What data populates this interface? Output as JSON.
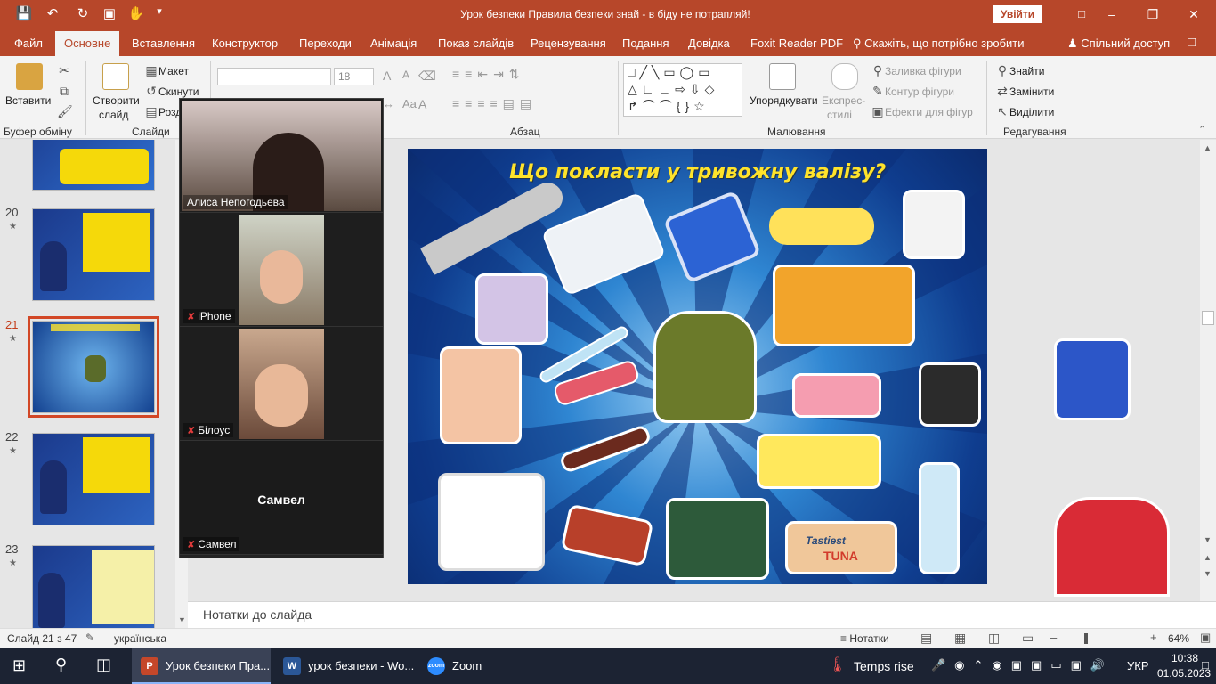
{
  "window": {
    "title": "Урок безпеки Правила безпеки знай - в біду не потрапляй!",
    "signin": "Увійти"
  },
  "tabs": [
    {
      "label": "Файл"
    },
    {
      "label": "Основне"
    },
    {
      "label": "Вставлення"
    },
    {
      "label": "Конструктор"
    },
    {
      "label": "Переходи"
    },
    {
      "label": "Анімація"
    },
    {
      "label": "Показ слайдів"
    },
    {
      "label": "Рецензування"
    },
    {
      "label": "Подання"
    },
    {
      "label": "Довідка"
    },
    {
      "label": "Foxit Reader PDF"
    }
  ],
  "tell_me": "Скажіть, що потрібно зробити",
  "share": "Спільний доступ",
  "ribbon": {
    "paste": "Вставити",
    "clipboard": "Буфер обміну",
    "new_slide_1": "Створити",
    "new_slide_2": "слайд",
    "layout": "Макет",
    "reset": "Скинути",
    "section": "Розділ",
    "slides": "Слайди",
    "font_size": "18",
    "paragraph": "Абзац",
    "arrange": "Упорядкувати",
    "express_1": "Експрес-",
    "express_2": "стилі",
    "fill": "Заливка фігури",
    "outline": "Контур фігури",
    "effects": "Ефекти для фігур",
    "drawing": "Малювання",
    "find": "Знайти",
    "replace": "Замінити",
    "select": "Виділити",
    "editing": "Редагування"
  },
  "thumbnails": [
    {
      "num": "20"
    },
    {
      "num": "21"
    },
    {
      "num": "22"
    },
    {
      "num": "23"
    }
  ],
  "zoom": [
    {
      "name": "Алиса Непогодьева"
    },
    {
      "name": "iPhone"
    },
    {
      "name": "Білоус"
    },
    {
      "name": "Самвел",
      "center": "Самвел"
    }
  ],
  "slide": {
    "title": "Що покласти у тривожну валізу?",
    "tuna_1": "Tastiest",
    "tuna_2": "TUNA"
  },
  "notes_placeholder": "Нотатки до слайда",
  "status": {
    "slide": "Слайд 21 з 47",
    "language": "українська",
    "notes": "Нотатки",
    "zoom": "64%"
  },
  "taskbar": {
    "app1": "Урок безпеки Пра...",
    "app2": "урок безпеки - Wo...",
    "app3": "Zoom",
    "weather": "Temps rise",
    "lang": "УКР",
    "time": "10:38",
    "date": "01.05.2023"
  },
  "colors": {
    "accent": "#b7472a",
    "ribbon": "#f3f3f3",
    "taskbar": "#1c2333",
    "slide_title": "#ffe32b"
  }
}
